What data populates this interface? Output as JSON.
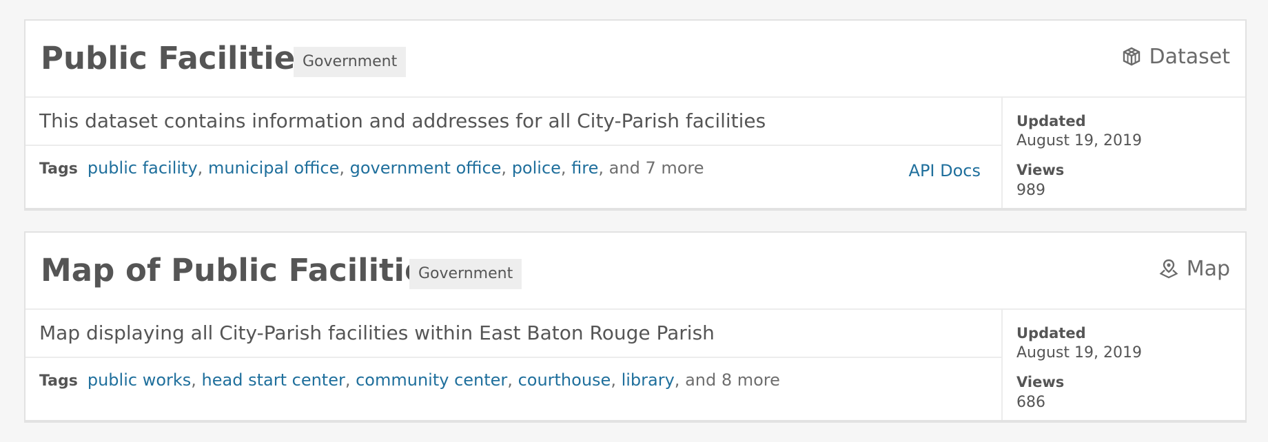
{
  "results": [
    {
      "title": "Public Facilities",
      "category": "Government",
      "type_label": "Dataset",
      "type_icon": "cube-icon",
      "description": "This dataset contains information and addresses for all City-Parish facilities",
      "tags_label": "Tags",
      "tags": [
        "public facility",
        "municipal office",
        "government office",
        "police",
        "fire"
      ],
      "more": "and 7 more",
      "api_docs": "API Docs",
      "updated_label": "Updated",
      "updated": "August 19, 2019",
      "views_label": "Views",
      "views": "989"
    },
    {
      "title": "Map of Public Facilities",
      "category": "Government",
      "type_label": "Map",
      "type_icon": "map-pin-icon",
      "description": "Map displaying all City-Parish facilities within East Baton Rouge Parish",
      "tags_label": "Tags",
      "tags": [
        "public works",
        "head start center",
        "community center",
        "courthouse",
        "library"
      ],
      "more": "and 8 more",
      "updated_label": "Updated",
      "updated": "August 19, 2019",
      "views_label": "Views",
      "views": "686"
    }
  ],
  "colors": {
    "link": "#1f6f9c",
    "text": "#555555",
    "badge_bg": "#eeeeee",
    "page_bg": "#f6f6f6"
  }
}
